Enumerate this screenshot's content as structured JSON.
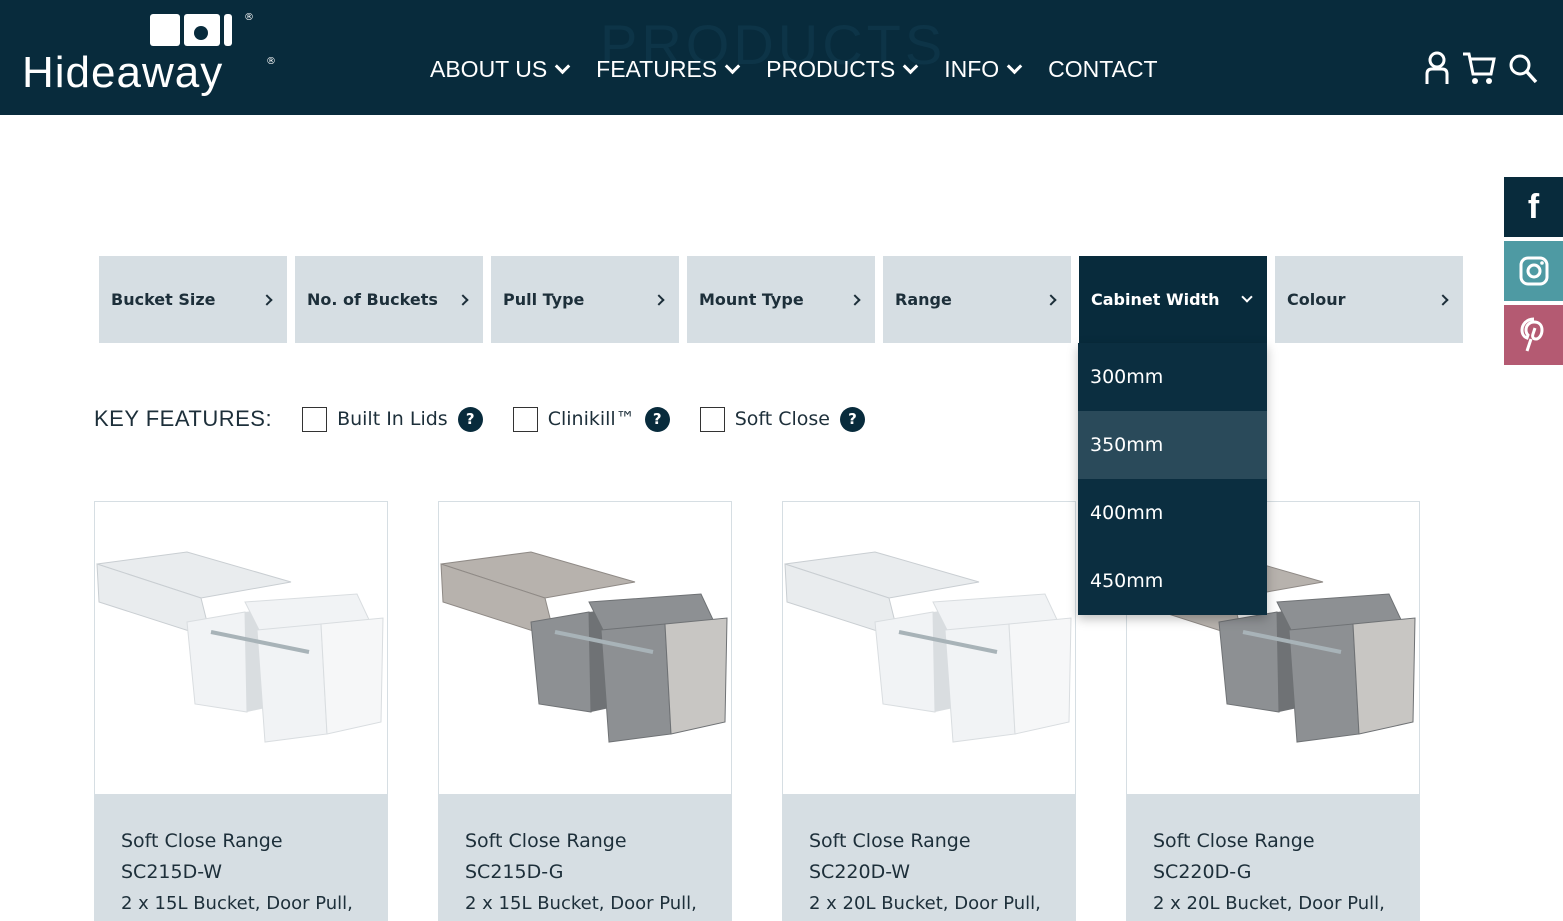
{
  "header": {
    "logo_text": "Hideaway",
    "ghost_title": "PRODUCTS",
    "nav": [
      {
        "label": "ABOUT US"
      },
      {
        "label": "FEATURES"
      },
      {
        "label": "PRODUCTS"
      },
      {
        "label": "INFO"
      },
      {
        "label": "CONTACT"
      }
    ],
    "icons": [
      "user-icon",
      "cart-icon",
      "search-icon"
    ]
  },
  "social": {
    "facebook": "f",
    "colors": {
      "facebook": "#082b3c",
      "instagram": "#4e9aa3",
      "pinterest": "#b45a72"
    }
  },
  "filters": [
    {
      "label": "Bucket Size"
    },
    {
      "label": "No. of Buckets"
    },
    {
      "label": "Pull Type"
    },
    {
      "label": "Mount Type"
    },
    {
      "label": "Range"
    },
    {
      "label": "Cabinet Width",
      "open": true
    },
    {
      "label": "Colour"
    }
  ],
  "dropdown": {
    "options": [
      "300mm",
      "350mm",
      "400mm",
      "450mm"
    ],
    "hovered": "350mm"
  },
  "key_features": {
    "title": "KEY FEATURES:",
    "items": [
      {
        "label": "Built In Lids",
        "help": "?"
      },
      {
        "label": "Clinikill™",
        "help": "?"
      },
      {
        "label": "Soft Close",
        "help": "?"
      }
    ]
  },
  "products": [
    {
      "name": "Soft Close Range SC215D-W",
      "desc": "2 x 15L Bucket, Door Pull,",
      "finish": "white"
    },
    {
      "name": "Soft Close Range SC215D-G",
      "desc": "2 x 15L Bucket, Door Pull,",
      "finish": "grey"
    },
    {
      "name": "Soft Close Range SC220D-W",
      "desc": "2 x 20L Bucket, Door Pull,",
      "finish": "white"
    },
    {
      "name": "Soft Close Range SC220D-G",
      "desc": "2 x 20L Bucket, Door Pull,",
      "finish": "grey"
    }
  ],
  "colors": {
    "navy": "#082b3c",
    "filter_bg": "#d6dee3"
  }
}
